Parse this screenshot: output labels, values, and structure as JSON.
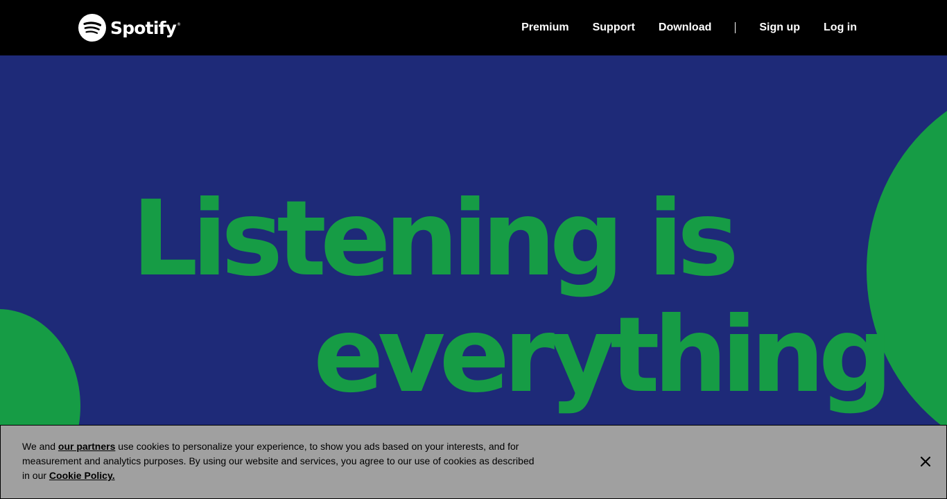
{
  "header": {
    "logo_text": "Spotify",
    "logo_mark": "®",
    "logo_icon": "spotify-logo-icon",
    "nav": {
      "premium": "Premium",
      "support": "Support",
      "download": "Download",
      "signup": "Sign up",
      "login": "Log in"
    }
  },
  "hero": {
    "line1": "Listening is",
    "line2": "everything"
  },
  "cookie": {
    "text_1": "We and ",
    "partners_link": "our partners",
    "text_2": " use cookies to personalize your experience, to show you ads based on your interests, and for measurement and analytics purposes. By using our website and services, you agree to our use of cookies as described in our ",
    "policy_link": "Cookie Policy.",
    "close_icon": "close-icon"
  },
  "colors": {
    "header_bg": "#000000",
    "hero_bg": "#1e2a78",
    "accent_green": "#169c45",
    "banner_bg": "#a0a0a0"
  }
}
